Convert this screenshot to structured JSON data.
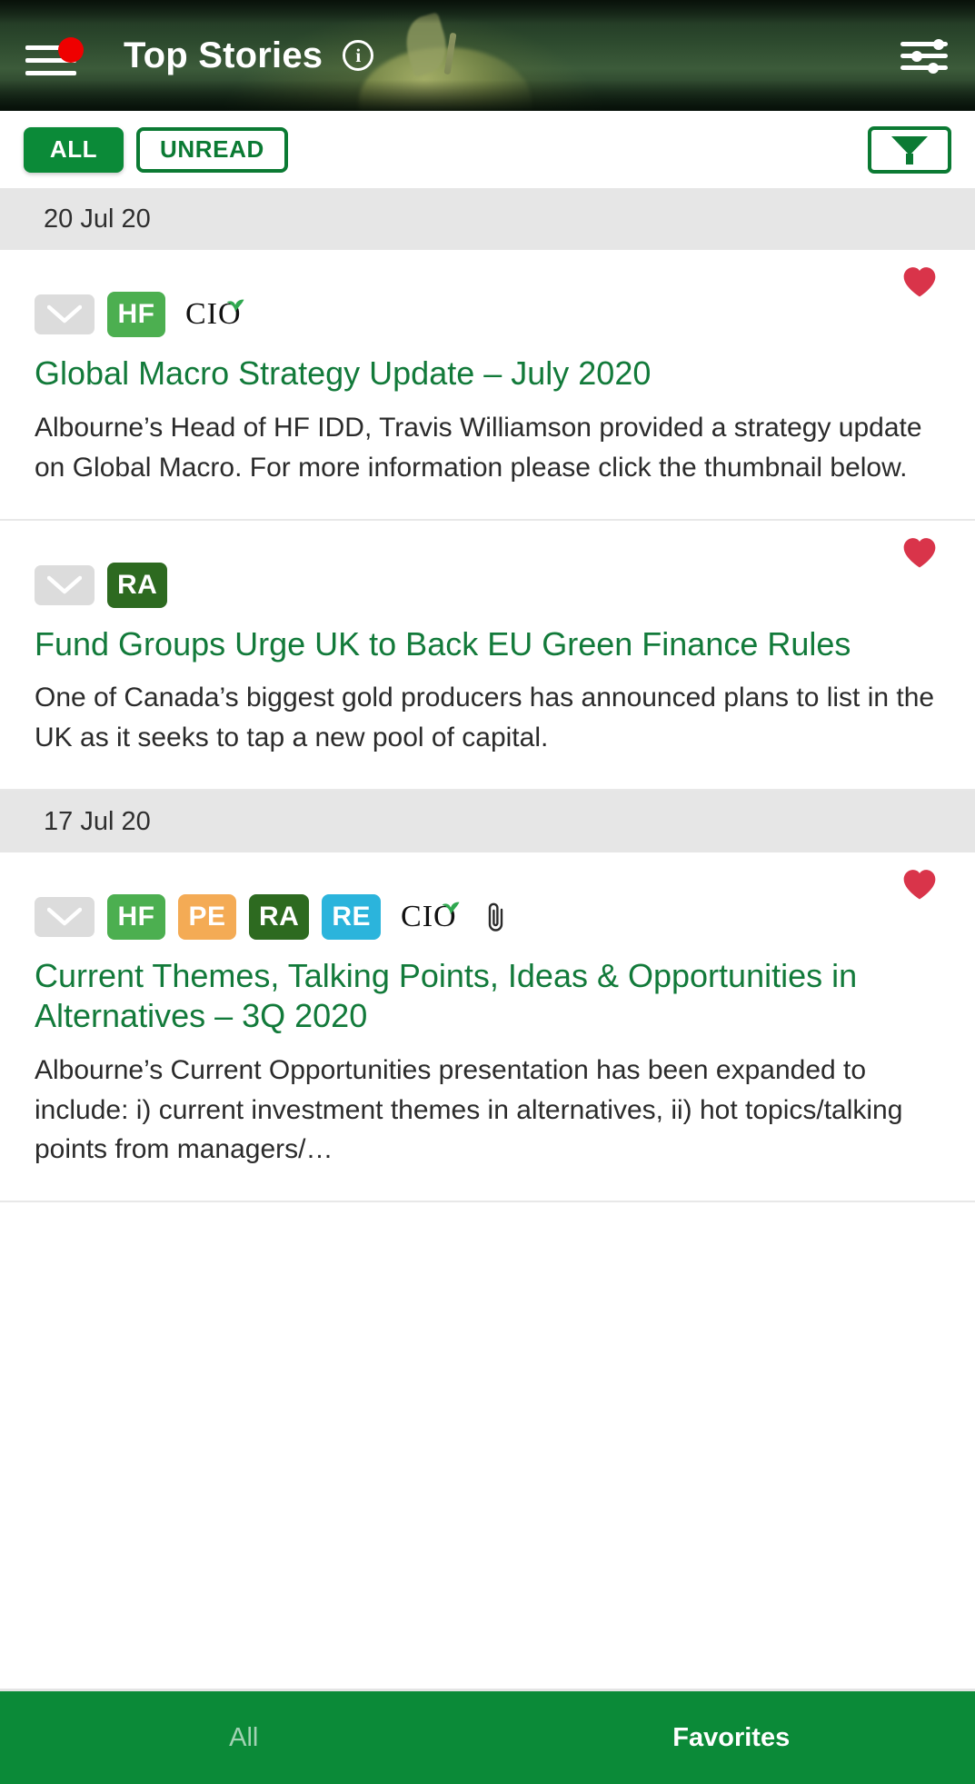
{
  "header": {
    "title": "Top Stories",
    "menu_icon": "hamburger-menu-icon",
    "notification_badge": true,
    "info_icon": "info-circle-icon",
    "settings_icon": "sliders-settings-icon"
  },
  "filter_bar": {
    "all_label": "ALL",
    "unread_label": "UNREAD",
    "active": "ALL",
    "filter_icon": "funnel-filter-icon"
  },
  "colors": {
    "brand_green": "#0b8a38",
    "title_green": "#127a3a",
    "tag_hf": "#4caf50",
    "tag_pe": "#f4ab55",
    "tag_ra": "#2d6a20",
    "tag_re": "#2bb4dc",
    "heart_red": "#d9344a",
    "date_header_bg": "#e6e6e6",
    "envelope_gray": "#dcdcdc"
  },
  "groups": [
    {
      "date": "20 Jul 20",
      "articles": [
        {
          "favorited": true,
          "envelope": "unread-envelope-icon",
          "tags": [
            {
              "label": "HF",
              "color": "#4caf50"
            }
          ],
          "cio_logo": true,
          "attachment": false,
          "title": "Global Macro Strategy Update – July 2020",
          "body": "Albourne’s Head of HF IDD, Travis Williamson provided a strategy update on Global Macro. For more information please click the thumbnail below."
        },
        {
          "favorited": true,
          "envelope": "unread-envelope-icon",
          "tags": [
            {
              "label": "RA",
              "color": "#2d6a20"
            }
          ],
          "cio_logo": false,
          "attachment": false,
          "title": "Fund Groups Urge UK to Back EU Green Finance Rules",
          "body": "One of Canada’s biggest gold producers has announced plans to list in the UK as it seeks to tap a new pool of capital."
        }
      ]
    },
    {
      "date": "17 Jul 20",
      "articles": [
        {
          "favorited": true,
          "envelope": "unread-envelope-icon",
          "tags": [
            {
              "label": "HF",
              "color": "#4caf50"
            },
            {
              "label": "PE",
              "color": "#f4ab55"
            },
            {
              "label": "RA",
              "color": "#2d6a20"
            },
            {
              "label": "RE",
              "color": "#2bb4dc"
            }
          ],
          "cio_logo": true,
          "attachment": true,
          "title": "Current Themes, Talking Points, Ideas & Opportunities in Alternatives – 3Q 2020",
          "body": "Albourne’s Current Opportunities presentation has been expanded to include: i) current investment themes in alternatives, ii) hot topics/talking points from managers/…"
        }
      ]
    }
  ],
  "bottom_nav": {
    "items": [
      {
        "label": "All",
        "active": false
      },
      {
        "label": "Favorites",
        "active": true
      }
    ]
  }
}
